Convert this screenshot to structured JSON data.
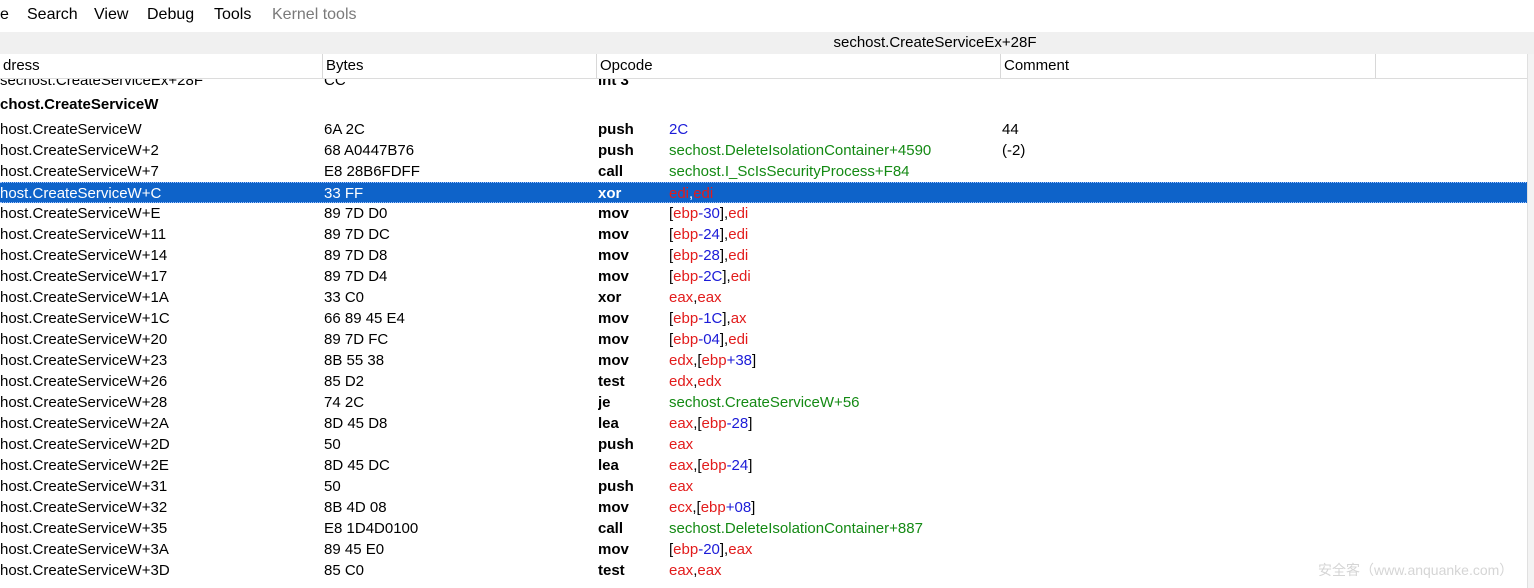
{
  "menubar": {
    "items": [
      {
        "label": "e",
        "enabled": true
      },
      {
        "label": "Search",
        "enabled": true
      },
      {
        "label": "View",
        "enabled": true
      },
      {
        "label": "Debug",
        "enabled": true
      },
      {
        "label": "Tools",
        "enabled": true
      },
      {
        "label": "Kernel tools",
        "enabled": false
      }
    ]
  },
  "location": "sechost.CreateServiceEx+28F",
  "columns": [
    "dress",
    "Bytes",
    "Opcode",
    "Comment"
  ],
  "top_partial_row": {
    "address": "sechost.CreateServiceEx+28F",
    "bytes": "CC",
    "opcode": "int 3"
  },
  "label": "chost.CreateServiceW",
  "selected_index": 3,
  "rows": [
    {
      "address": "host.CreateServiceW",
      "bytes": "6A 2C",
      "opcode": "push",
      "args": [
        {
          "t": "2C",
          "c": "blue"
        }
      ],
      "comment": "44"
    },
    {
      "address": "host.CreateServiceW+2",
      "bytes": "68 A0447B76",
      "opcode": "push",
      "args": [
        {
          "t": "sechost.DeleteIsolationContainer+4590",
          "c": "green"
        }
      ],
      "comment": "(-2)"
    },
    {
      "address": "host.CreateServiceW+7",
      "bytes": "E8 28B6FDFF",
      "opcode": "call",
      "args": [
        {
          "t": "sechost.I_ScIsSecurityProcess+F84",
          "c": "green"
        }
      ],
      "comment": ""
    },
    {
      "address": "host.CreateServiceW+C",
      "bytes": "33 FF",
      "opcode": "xor",
      "args": [
        {
          "t": "edi",
          "c": "red"
        },
        {
          "t": ",",
          "c": "black"
        },
        {
          "t": "edi",
          "c": "red"
        }
      ],
      "comment": ""
    },
    {
      "address": "host.CreateServiceW+E",
      "bytes": "89 7D D0",
      "opcode": "mov",
      "args": [
        {
          "t": "[",
          "c": "black"
        },
        {
          "t": "ebp",
          "c": "red"
        },
        {
          "t": "-30",
          "c": "blue"
        },
        {
          "t": "],",
          "c": "black"
        },
        {
          "t": "edi",
          "c": "red"
        }
      ],
      "comment": ""
    },
    {
      "address": "host.CreateServiceW+11",
      "bytes": "89 7D DC",
      "opcode": "mov",
      "args": [
        {
          "t": "[",
          "c": "black"
        },
        {
          "t": "ebp",
          "c": "red"
        },
        {
          "t": "-24",
          "c": "blue"
        },
        {
          "t": "],",
          "c": "black"
        },
        {
          "t": "edi",
          "c": "red"
        }
      ],
      "comment": ""
    },
    {
      "address": "host.CreateServiceW+14",
      "bytes": "89 7D D8",
      "opcode": "mov",
      "args": [
        {
          "t": "[",
          "c": "black"
        },
        {
          "t": "ebp",
          "c": "red"
        },
        {
          "t": "-28",
          "c": "blue"
        },
        {
          "t": "],",
          "c": "black"
        },
        {
          "t": "edi",
          "c": "red"
        }
      ],
      "comment": ""
    },
    {
      "address": "host.CreateServiceW+17",
      "bytes": "89 7D D4",
      "opcode": "mov",
      "args": [
        {
          "t": "[",
          "c": "black"
        },
        {
          "t": "ebp",
          "c": "red"
        },
        {
          "t": "-2C",
          "c": "blue"
        },
        {
          "t": "],",
          "c": "black"
        },
        {
          "t": "edi",
          "c": "red"
        }
      ],
      "comment": ""
    },
    {
      "address": "host.CreateServiceW+1A",
      "bytes": "33 C0",
      "opcode": "xor",
      "args": [
        {
          "t": "eax",
          "c": "red"
        },
        {
          "t": ",",
          "c": "black"
        },
        {
          "t": "eax",
          "c": "red"
        }
      ],
      "comment": ""
    },
    {
      "address": "host.CreateServiceW+1C",
      "bytes": "66 89 45 E4",
      "opcode": "mov",
      "args": [
        {
          "t": "[",
          "c": "black"
        },
        {
          "t": "ebp",
          "c": "red"
        },
        {
          "t": "-1C",
          "c": "blue"
        },
        {
          "t": "],",
          "c": "black"
        },
        {
          "t": "ax",
          "c": "red"
        }
      ],
      "comment": ""
    },
    {
      "address": "host.CreateServiceW+20",
      "bytes": "89 7D FC",
      "opcode": "mov",
      "args": [
        {
          "t": "[",
          "c": "black"
        },
        {
          "t": "ebp",
          "c": "red"
        },
        {
          "t": "-04",
          "c": "blue"
        },
        {
          "t": "],",
          "c": "black"
        },
        {
          "t": "edi",
          "c": "red"
        }
      ],
      "comment": ""
    },
    {
      "address": "host.CreateServiceW+23",
      "bytes": "8B 55 38",
      "opcode": "mov",
      "args": [
        {
          "t": "edx",
          "c": "red"
        },
        {
          "t": ",[",
          "c": "black"
        },
        {
          "t": "ebp",
          "c": "red"
        },
        {
          "t": "+38",
          "c": "blue"
        },
        {
          "t": "]",
          "c": "black"
        }
      ],
      "comment": ""
    },
    {
      "address": "host.CreateServiceW+26",
      "bytes": "85 D2",
      "opcode": "test",
      "args": [
        {
          "t": "edx",
          "c": "red"
        },
        {
          "t": ",",
          "c": "black"
        },
        {
          "t": "edx",
          "c": "red"
        }
      ],
      "comment": ""
    },
    {
      "address": "host.CreateServiceW+28",
      "bytes": "74 2C",
      "opcode": "je",
      "args": [
        {
          "t": "sechost.CreateServiceW+56",
          "c": "green"
        }
      ],
      "comment": ""
    },
    {
      "address": "host.CreateServiceW+2A",
      "bytes": "8D 45 D8",
      "opcode": "lea",
      "args": [
        {
          "t": "eax",
          "c": "red"
        },
        {
          "t": ",[",
          "c": "black"
        },
        {
          "t": "ebp",
          "c": "red"
        },
        {
          "t": "-28",
          "c": "blue"
        },
        {
          "t": "]",
          "c": "black"
        }
      ],
      "comment": ""
    },
    {
      "address": "host.CreateServiceW+2D",
      "bytes": "50",
      "opcode": "push",
      "args": [
        {
          "t": "eax",
          "c": "red"
        }
      ],
      "comment": ""
    },
    {
      "address": "host.CreateServiceW+2E",
      "bytes": "8D 45 DC",
      "opcode": "lea",
      "args": [
        {
          "t": "eax",
          "c": "red"
        },
        {
          "t": ",[",
          "c": "black"
        },
        {
          "t": "ebp",
          "c": "red"
        },
        {
          "t": "-24",
          "c": "blue"
        },
        {
          "t": "]",
          "c": "black"
        }
      ],
      "comment": ""
    },
    {
      "address": "host.CreateServiceW+31",
      "bytes": "50",
      "opcode": "push",
      "args": [
        {
          "t": "eax",
          "c": "red"
        }
      ],
      "comment": ""
    },
    {
      "address": "host.CreateServiceW+32",
      "bytes": "8B 4D 08",
      "opcode": "mov",
      "args": [
        {
          "t": "ecx",
          "c": "red"
        },
        {
          "t": ",[",
          "c": "black"
        },
        {
          "t": "ebp",
          "c": "red"
        },
        {
          "t": "+08",
          "c": "blue"
        },
        {
          "t": "]",
          "c": "black"
        }
      ],
      "comment": ""
    },
    {
      "address": "host.CreateServiceW+35",
      "bytes": "E8 1D4D0100",
      "opcode": "call",
      "args": [
        {
          "t": "sechost.DeleteIsolationContainer+887",
          "c": "green"
        }
      ],
      "comment": ""
    },
    {
      "address": "host.CreateServiceW+3A",
      "bytes": "89 45 E0",
      "opcode": "mov",
      "args": [
        {
          "t": "[",
          "c": "black"
        },
        {
          "t": "ebp",
          "c": "red"
        },
        {
          "t": "-20",
          "c": "blue"
        },
        {
          "t": "],",
          "c": "black"
        },
        {
          "t": "eax",
          "c": "red"
        }
      ],
      "comment": ""
    },
    {
      "address": "host.CreateServiceW+3D",
      "bytes": "85 C0",
      "opcode": "test",
      "args": [
        {
          "t": "eax",
          "c": "red"
        },
        {
          "t": ",",
          "c": "black"
        },
        {
          "t": "eax",
          "c": "red"
        }
      ],
      "comment": ""
    }
  ],
  "watermark": "安全客（www.anquanke.com）"
}
